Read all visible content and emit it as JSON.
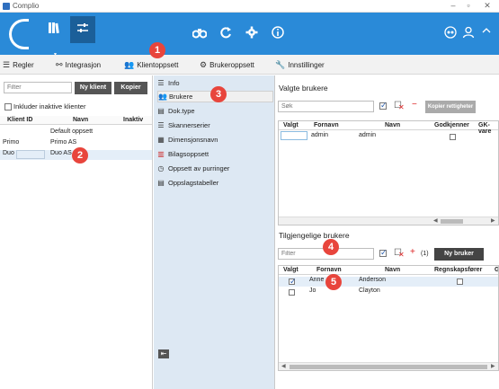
{
  "window": {
    "title": "Complio"
  },
  "menu": {
    "items": [
      {
        "label": "Regler",
        "icon": "list-icon"
      },
      {
        "label": "Integrasjon",
        "icon": "link-icon"
      },
      {
        "label": "Klientoppsett",
        "icon": "users-icon"
      },
      {
        "label": "Brukeroppsett",
        "icon": "user-settings-icon"
      },
      {
        "label": "Innstillinger",
        "icon": "wrench-icon"
      }
    ]
  },
  "left": {
    "filter_placeholder": "Filter",
    "new_client_label": "Ny klient",
    "copy_label": "Kopier",
    "include_inactive_label": "Inkluder inaktive klienter",
    "columns": [
      "Klient ID",
      "Navn",
      "Inaktiv"
    ],
    "rows": [
      {
        "id": "",
        "name": "Default oppsett"
      },
      {
        "id": "Primo",
        "name": "Primo AS"
      },
      {
        "id": "Duo",
        "name": "Duo AS"
      }
    ]
  },
  "mid": {
    "items": [
      {
        "label": "Info"
      },
      {
        "label": "Brukere"
      },
      {
        "label": "Dok.type"
      },
      {
        "label": "Skannerserier"
      },
      {
        "label": "Dimensjonsnavn"
      },
      {
        "label": "Bilagsoppsett"
      },
      {
        "label": "Oppsett av purringer"
      },
      {
        "label": "Oppslagstabeller"
      }
    ]
  },
  "selected_users": {
    "title": "Valgte brukere",
    "filter_placeholder": "Søk",
    "copy_rights_label": "Kopier rettigheter",
    "columns": [
      "Valgt",
      "Fornavn",
      "Navn",
      "Godkjenner",
      "GK-vare"
    ],
    "rows": [
      {
        "first": "admin",
        "last": "admin"
      }
    ]
  },
  "available_users": {
    "title": "Tilgjengelige brukere",
    "filter_placeholder": "Filter",
    "count": "(1)",
    "new_user_label": "Ny bruker",
    "columns": [
      "Valgt",
      "Fornavn",
      "Navn",
      "Regnskapsfører",
      "G"
    ],
    "rows": [
      {
        "first": "Anne",
        "last": "Anderson",
        "checked": true
      },
      {
        "first": "Jo",
        "last": "Clayton",
        "checked": false
      }
    ]
  },
  "badges": [
    "1",
    "2",
    "3",
    "4",
    "5"
  ],
  "colors": {
    "topbar": "#2a8ad8",
    "accent_red": "#e8453c",
    "nav_panel": "#dde8f3"
  }
}
